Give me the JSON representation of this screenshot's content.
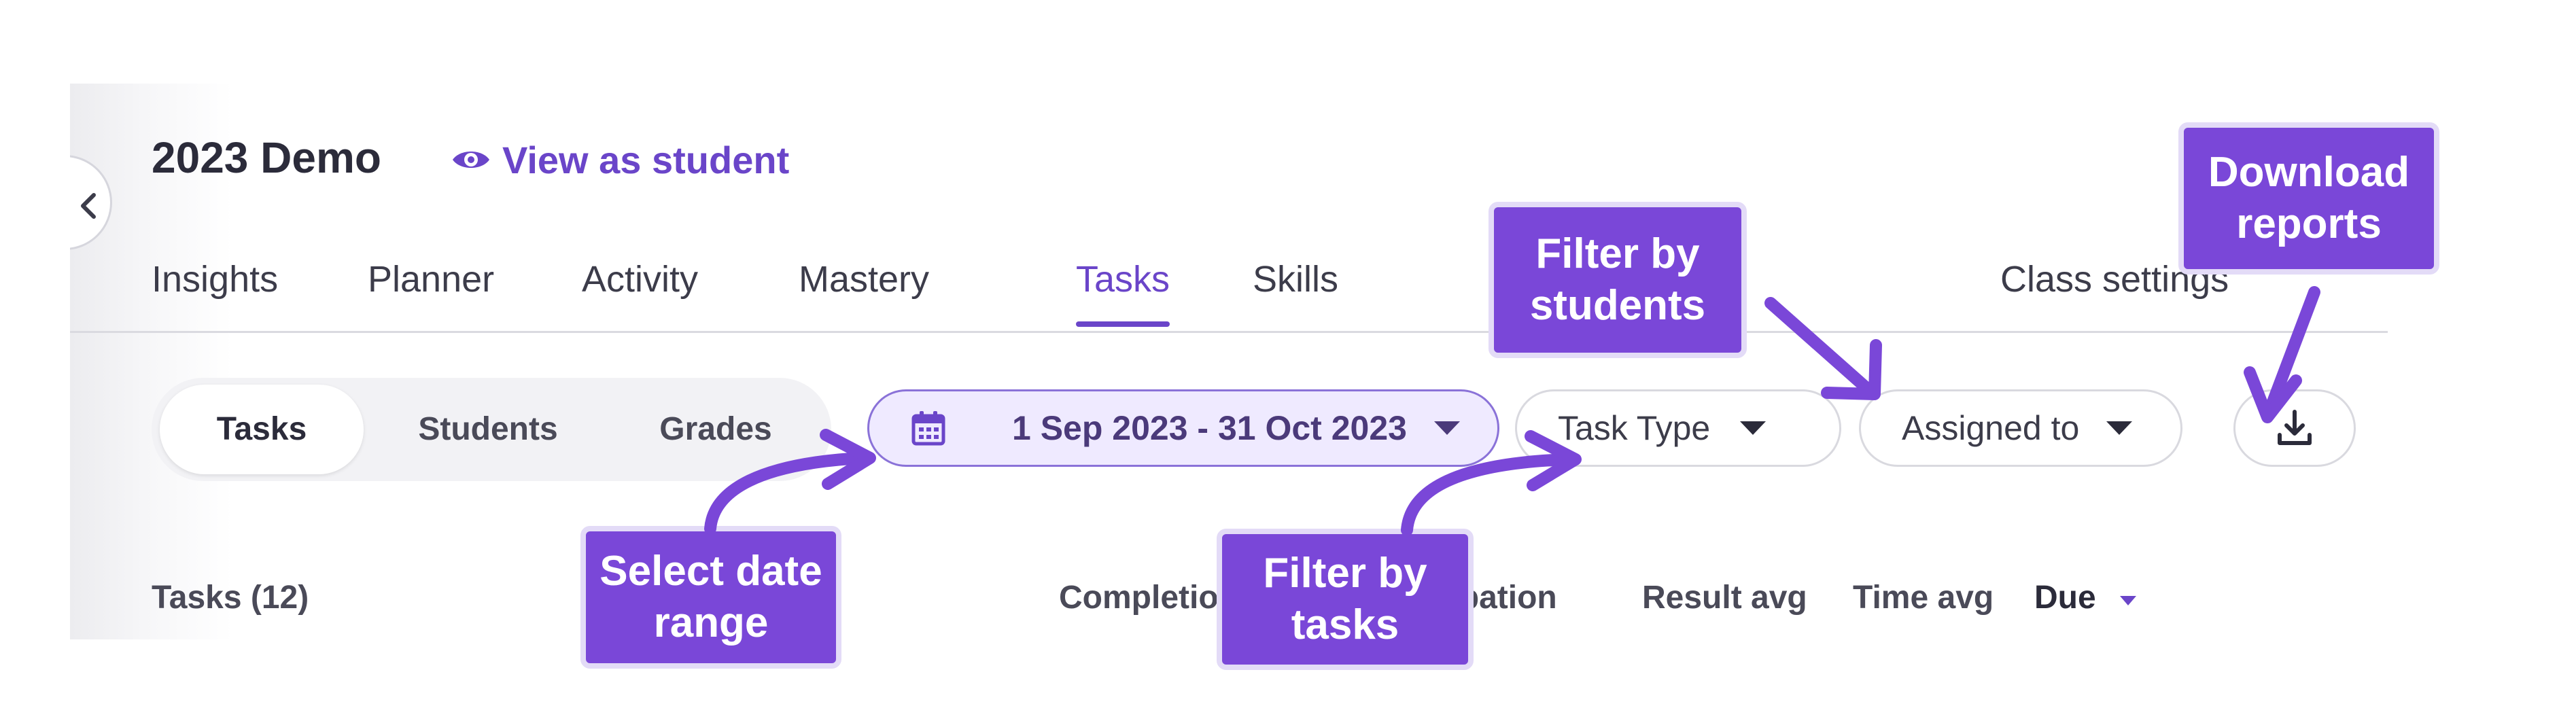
{
  "header": {
    "title": "2023 Demo",
    "view_as_student": "View as student"
  },
  "nav": {
    "tabs": [
      {
        "label": "Insights"
      },
      {
        "label": "Planner"
      },
      {
        "label": "Activity"
      },
      {
        "label": "Mastery"
      },
      {
        "label": "Tasks",
        "active": true
      },
      {
        "label": "Skills"
      }
    ],
    "class_settings": "Class settings"
  },
  "segmented": {
    "items": [
      {
        "label": "Tasks",
        "active": true
      },
      {
        "label": "Students"
      },
      {
        "label": "Grades"
      }
    ]
  },
  "filters": {
    "date_range": "1 Sep 2023 - 31 Oct 2023",
    "task_type": "Task Type",
    "assigned_to": "Assigned to"
  },
  "table": {
    "count_label": "Tasks (12)",
    "columns": {
      "completion": "Completion",
      "participation": "Participation",
      "result_avg": "Result avg",
      "time_avg": "Time avg",
      "due": "Due"
    }
  },
  "callouts": {
    "select_date_range": "Select date range",
    "filter_by_tasks": "Filter by tasks",
    "filter_by_students": "Filter by students",
    "download_reports": "Download reports"
  },
  "icons": {
    "view_as_student": "eye-icon",
    "date": "calendar-icon",
    "download": "download-icon",
    "collapse": "chevron-left-icon"
  },
  "colors": {
    "accent": "#6a45c9",
    "callout": "#7a47d8",
    "callout_border": "#e3dbf7",
    "date_pill_bg": "#efeaff"
  }
}
